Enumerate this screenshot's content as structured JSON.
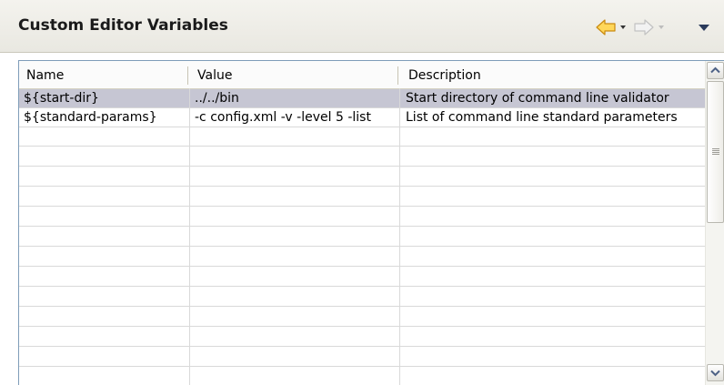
{
  "panel": {
    "title": "Custom Editor Variables"
  },
  "toolbar": {
    "back_icon": "back-arrow-icon",
    "back_menu_icon": "dropdown-triangle-icon",
    "forward_icon": "forward-arrow-icon",
    "forward_menu_icon": "dropdown-triangle-icon",
    "view_menu_icon": "view-menu-icon",
    "back_color": "#f0b030",
    "forward_color": "#d6d6d6"
  },
  "table": {
    "columns": [
      "Name",
      "Value",
      "Description"
    ],
    "rows": [
      {
        "name": "${start-dir}",
        "value": "../../bin",
        "description": "Start directory of command line validator",
        "selected": true
      },
      {
        "name": "${standard-params}",
        "value": "-c config.xml -v -level 5 -list",
        "description": "List of command line standard parameters",
        "selected": false
      }
    ],
    "selected_row_color": "#c6c6d3"
  },
  "scrollbar": {
    "up_icon": "scroll-up-arrow-icon",
    "down_icon": "scroll-down-arrow-icon"
  }
}
